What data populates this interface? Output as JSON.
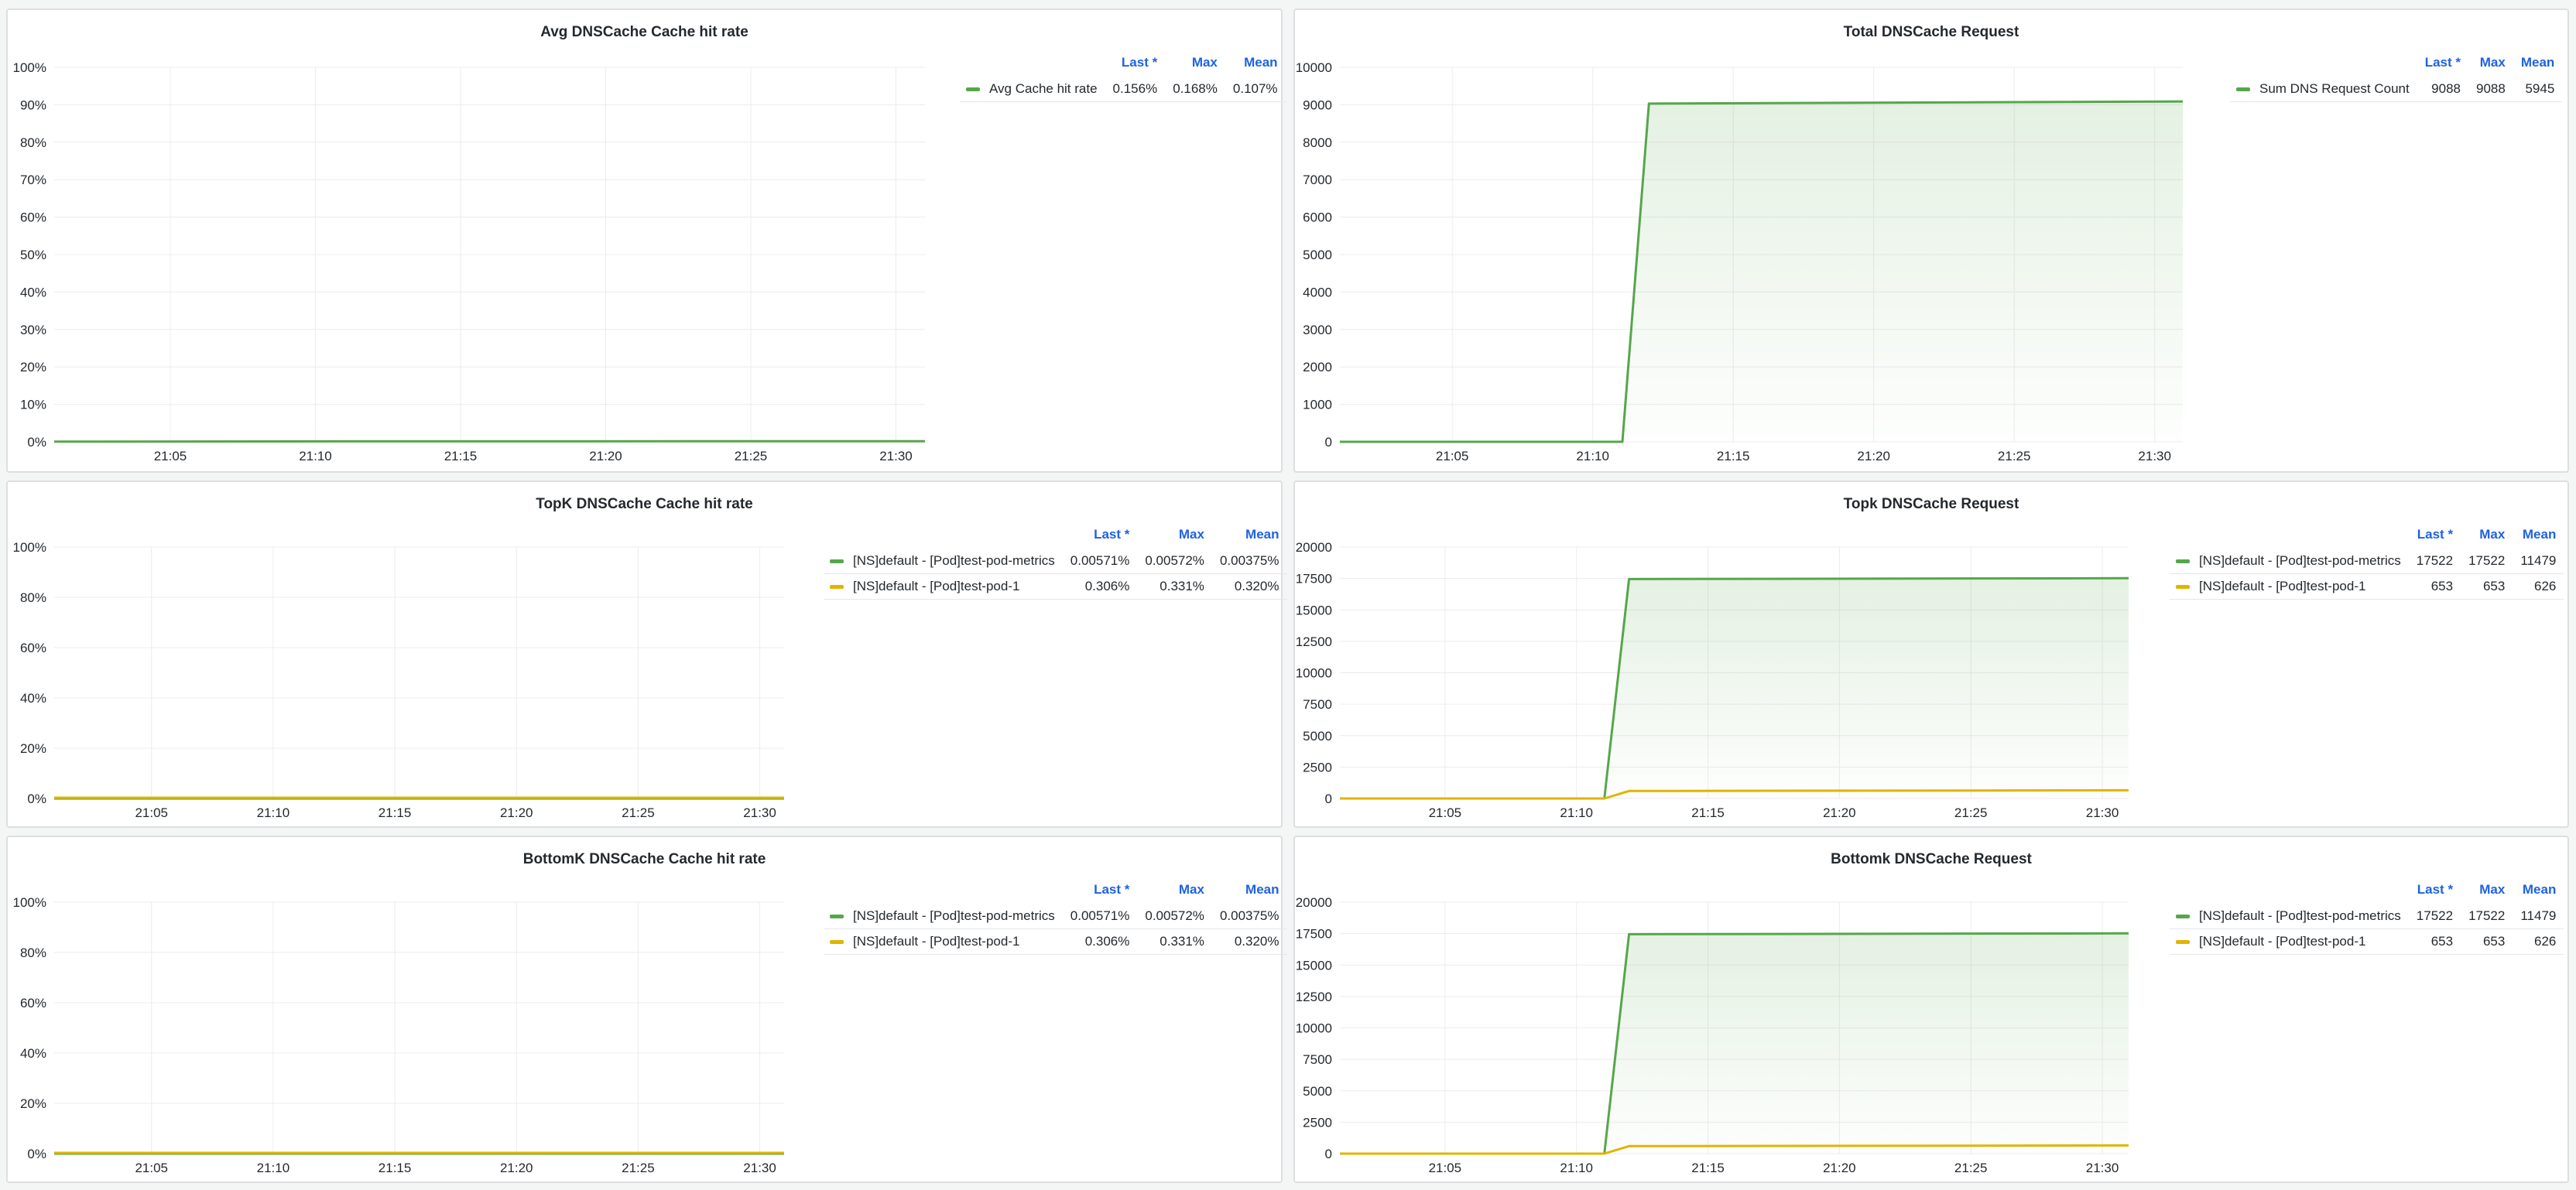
{
  "colors": {
    "green": "#56a64b",
    "yellow": "#e0b400",
    "fill": "#56a64b",
    "grid": "#ececec",
    "header_blue": "#1f62e0"
  },
  "legend_headers": {
    "last": "Last *",
    "max": "Max",
    "mean": "Mean"
  },
  "chart_data": [
    {
      "type": "line",
      "title": "Avg DNSCache Cache hit rate",
      "xlabel": "",
      "ylabel": "",
      "x_ticks": [
        "21:05",
        "21:10",
        "21:15",
        "21:20",
        "21:25",
        "21:30"
      ],
      "y_ticks": [
        "0%",
        "10%",
        "20%",
        "30%",
        "40%",
        "50%",
        "60%",
        "70%",
        "80%",
        "90%",
        "100%"
      ],
      "ylim": [
        0,
        100
      ],
      "xlim": [
        "21:01",
        "21:31"
      ],
      "grid": true,
      "legend_position": "right",
      "series": [
        {
          "name": "Avg Cache hit rate",
          "color": "#56a64b",
          "fill": false,
          "x": [
            "21:01",
            "21:11",
            "21:31"
          ],
          "y": [
            0.05,
            0.12,
            0.156
          ],
          "last": "0.156%",
          "max": "0.168%",
          "mean": "0.107%"
        }
      ]
    },
    {
      "type": "area",
      "title": "Total DNSCache Request",
      "xlabel": "",
      "ylabel": "",
      "x_ticks": [
        "21:05",
        "21:10",
        "21:15",
        "21:20",
        "21:25",
        "21:30"
      ],
      "y_ticks": [
        "0",
        "1000",
        "2000",
        "3000",
        "4000",
        "5000",
        "6000",
        "7000",
        "8000",
        "9000",
        "10000"
      ],
      "ylim": [
        0,
        10000
      ],
      "xlim": [
        "21:01",
        "21:31"
      ],
      "grid": true,
      "legend_position": "right",
      "series": [
        {
          "name": "Sum DNS Request Count",
          "color": "#56a64b",
          "fill": true,
          "x": [
            "21:01",
            "21:11",
            "21:11",
            "21:12",
            "21:31"
          ],
          "y": [
            0,
            0,
            0,
            9030,
            9088
          ],
          "last": "9088",
          "max": "9088",
          "mean": "5945"
        }
      ]
    },
    {
      "type": "line",
      "title": "TopK DNSCache Cache hit rate",
      "xlabel": "",
      "ylabel": "",
      "x_ticks": [
        "21:05",
        "21:10",
        "21:15",
        "21:20",
        "21:25",
        "21:30"
      ],
      "y_ticks": [
        "0%",
        "20%",
        "40%",
        "60%",
        "80%",
        "100%"
      ],
      "ylim": [
        0,
        100
      ],
      "xlim": [
        "21:01",
        "21:31"
      ],
      "grid": true,
      "legend_position": "right",
      "series": [
        {
          "name": "[NS]default - [Pod]test-pod-metrics",
          "color": "#56a64b",
          "fill": false,
          "x": [
            "21:01",
            "21:31"
          ],
          "y": [
            0.003,
            0.00571
          ],
          "last": "0.00571%",
          "max": "0.00572%",
          "mean": "0.00375%"
        },
        {
          "name": "[NS]default - [Pod]test-pod-1",
          "color": "#e0b400",
          "fill": false,
          "x": [
            "21:01",
            "21:11",
            "21:12",
            "21:31"
          ],
          "y": [
            0.31,
            0.31,
            0.32,
            0.306
          ],
          "last": "0.306%",
          "max": "0.331%",
          "mean": "0.320%"
        }
      ]
    },
    {
      "type": "area",
      "title": "Topk DNSCache Request",
      "xlabel": "",
      "ylabel": "",
      "x_ticks": [
        "21:05",
        "21:10",
        "21:15",
        "21:20",
        "21:25",
        "21:30"
      ],
      "y_ticks": [
        "0",
        "2500",
        "5000",
        "7500",
        "10000",
        "12500",
        "15000",
        "17500",
        "20000"
      ],
      "ylim": [
        0,
        20000
      ],
      "xlim": [
        "21:01",
        "21:31"
      ],
      "grid": true,
      "legend_position": "right",
      "series": [
        {
          "name": "[NS]default - [Pod]test-pod-metrics",
          "color": "#56a64b",
          "fill": true,
          "x": [
            "21:01",
            "21:11",
            "21:11",
            "21:12",
            "21:31"
          ],
          "y": [
            0,
            0,
            0,
            17450,
            17522
          ],
          "last": "17522",
          "max": "17522",
          "mean": "11479"
        },
        {
          "name": "[NS]default - [Pod]test-pod-1",
          "color": "#e0b400",
          "fill": false,
          "x": [
            "21:01",
            "21:11",
            "21:11",
            "21:12",
            "21:31"
          ],
          "y": [
            0,
            0,
            0,
            600,
            653
          ],
          "last": "653",
          "max": "653",
          "mean": "626"
        }
      ]
    },
    {
      "type": "line",
      "title": "BottomK DNSCache Cache hit rate",
      "xlabel": "",
      "ylabel": "",
      "x_ticks": [
        "21:05",
        "21:10",
        "21:15",
        "21:20",
        "21:25",
        "21:30"
      ],
      "y_ticks": [
        "0%",
        "20%",
        "40%",
        "60%",
        "80%",
        "100%"
      ],
      "ylim": [
        0,
        100
      ],
      "xlim": [
        "21:01",
        "21:31"
      ],
      "grid": true,
      "legend_position": "right",
      "series": [
        {
          "name": "[NS]default - [Pod]test-pod-metrics",
          "color": "#56a64b",
          "fill": false,
          "x": [
            "21:01",
            "21:31"
          ],
          "y": [
            0.003,
            0.00571
          ],
          "last": "0.00571%",
          "max": "0.00572%",
          "mean": "0.00375%"
        },
        {
          "name": "[NS]default - [Pod]test-pod-1",
          "color": "#e0b400",
          "fill": false,
          "x": [
            "21:01",
            "21:11",
            "21:12",
            "21:31"
          ],
          "y": [
            0.31,
            0.31,
            0.32,
            0.306
          ],
          "last": "0.306%",
          "max": "0.331%",
          "mean": "0.320%"
        }
      ]
    },
    {
      "type": "area",
      "title": "Bottomk DNSCache Request",
      "xlabel": "",
      "ylabel": "",
      "x_ticks": [
        "21:05",
        "21:10",
        "21:15",
        "21:20",
        "21:25",
        "21:30"
      ],
      "y_ticks": [
        "0",
        "2500",
        "5000",
        "7500",
        "10000",
        "12500",
        "15000",
        "17500",
        "20000"
      ],
      "ylim": [
        0,
        20000
      ],
      "xlim": [
        "21:01",
        "21:31"
      ],
      "grid": true,
      "legend_position": "right",
      "series": [
        {
          "name": "[NS]default - [Pod]test-pod-metrics",
          "color": "#56a64b",
          "fill": true,
          "x": [
            "21:01",
            "21:11",
            "21:11",
            "21:12",
            "21:31"
          ],
          "y": [
            0,
            0,
            0,
            17450,
            17522
          ],
          "last": "17522",
          "max": "17522",
          "mean": "11479"
        },
        {
          "name": "[NS]default - [Pod]test-pod-1",
          "color": "#e0b400",
          "fill": false,
          "x": [
            "21:01",
            "21:11",
            "21:11",
            "21:12",
            "21:31"
          ],
          "y": [
            0,
            0,
            0,
            600,
            653
          ],
          "last": "653",
          "max": "653",
          "mean": "626"
        }
      ]
    }
  ]
}
